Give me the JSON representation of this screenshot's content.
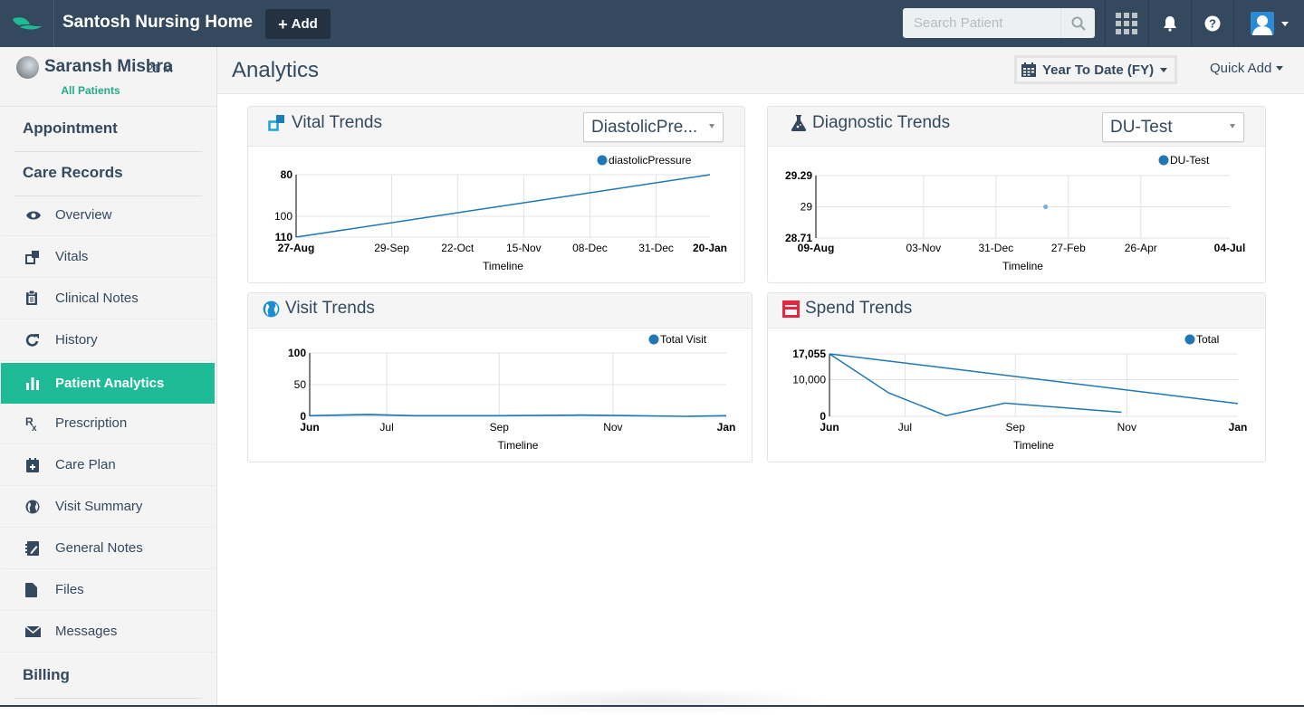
{
  "app": {
    "brand": "Santosh Nursing Home",
    "add_label": "Add",
    "search_placeholder": "Search Patient",
    "colors": {
      "nav": "#34495e",
      "accent": "#1fbb97",
      "link": "#27a98a",
      "series": "#1f77b4",
      "spend_icon": "#e8253e",
      "vital_icon": "#1aa3d6"
    }
  },
  "patient": {
    "name": "Saransh Mishra",
    "meta": "21 M",
    "all_patients": "All Patients"
  },
  "sidebar": {
    "sections": [
      {
        "label": "Appointment"
      },
      {
        "label": "Care Records"
      },
      {
        "label": "Billing"
      }
    ],
    "items": [
      {
        "label": "Overview",
        "icon": "eye-icon"
      },
      {
        "label": "Vitals",
        "icon": "vitals-icon"
      },
      {
        "label": "Clinical Notes",
        "icon": "clipboard-icon"
      },
      {
        "label": "History",
        "icon": "refresh-icon"
      },
      {
        "label": "Patient Analytics",
        "icon": "bar-chart-icon",
        "active": true
      },
      {
        "label": "Prescription",
        "icon": "rx-icon"
      },
      {
        "label": "Care Plan",
        "icon": "calendar-plus-icon"
      },
      {
        "label": "Visit Summary",
        "icon": "globe-icon"
      },
      {
        "label": "General Notes",
        "icon": "notebook-icon"
      },
      {
        "label": "Files",
        "icon": "file-icon"
      },
      {
        "label": "Messages",
        "icon": "envelope-icon"
      }
    ]
  },
  "header": {
    "title": "Analytics",
    "date_range": "Year To Date (FY)",
    "quick_add": "Quick Add"
  },
  "panels": {
    "vital": {
      "title": "Vital Trends",
      "selected": "DiastolicPre..."
    },
    "diagnostic": {
      "title": "Diagnostic Trends",
      "selected": "DU-Test"
    },
    "visit": {
      "title": "Visit Trends"
    },
    "spend": {
      "title": "Spend Trends"
    }
  },
  "chart_data": [
    {
      "id": "vital",
      "type": "line",
      "xlabel": "Timeline",
      "legend": [
        "diastolicPressure"
      ],
      "legend_position": "top-right",
      "x_ticks": [
        "27-Aug",
        "29-Sep",
        "22-Oct",
        "15-Nov",
        "08-Dec",
        "31-Dec",
        "20-Jan"
      ],
      "x_ticks_bold": [
        "27-Aug",
        "20-Jan"
      ],
      "y_ticks": [
        80,
        100,
        110
      ],
      "y_ticks_bold": [
        80,
        110
      ],
      "ylim": [
        110,
        80
      ],
      "y_inverted": true,
      "series": [
        {
          "name": "diastolicPressure",
          "x": [
            0,
            1
          ],
          "y": [
            110,
            80
          ]
        }
      ]
    },
    {
      "id": "diagnostic",
      "type": "scatter",
      "xlabel": "Timeline",
      "legend": [
        "DU-Test"
      ],
      "legend_position": "top-right",
      "x_ticks": [
        "09-Aug",
        "03-Nov",
        "31-Dec",
        "27-Feb",
        "26-Apr",
        "04-Jul"
      ],
      "x_ticks_bold": [
        "09-Aug",
        "04-Jul"
      ],
      "y_ticks": [
        29.29,
        29,
        28.71
      ],
      "y_ticks_bold": [
        29.29,
        28.71
      ],
      "ylim": [
        28.71,
        29.29
      ],
      "series": [
        {
          "name": "DU-Test",
          "x": [
            0.555
          ],
          "y": [
            29
          ]
        }
      ]
    },
    {
      "id": "visit",
      "type": "area",
      "xlabel": "Timeline",
      "legend": [
        "Total Visit"
      ],
      "legend_position": "top-right",
      "x_ticks": [
        "Jun",
        "Jul",
        "Sep",
        "Nov",
        "Jan"
      ],
      "x_ticks_bold": [
        "Jun",
        "Jan"
      ],
      "y_ticks": [
        100,
        50,
        0
      ],
      "y_ticks_bold": [
        100,
        0
      ],
      "ylim": [
        0,
        100
      ],
      "series": [
        {
          "name": "Total Visit",
          "x": [
            0,
            0.14,
            0.25,
            0.45,
            0.65,
            0.78,
            0.9,
            1
          ],
          "y": [
            1,
            3,
            1,
            1,
            2,
            1,
            0,
            1
          ]
        }
      ]
    },
    {
      "id": "spend",
      "type": "line",
      "xlabel": "Timeline",
      "legend": [
        "Total"
      ],
      "legend_position": "top-right",
      "x_ticks": [
        "Jun",
        "Jul",
        "Sep",
        "Nov",
        "Jan"
      ],
      "x_ticks_bold": [
        "Jun",
        "Jan"
      ],
      "y_ticks": [
        17055,
        10000,
        0
      ],
      "y_tick_labels": [
        "17,055",
        "10,000",
        "0"
      ],
      "y_ticks_bold": [
        17055,
        0
      ],
      "ylim": [
        0,
        17055
      ],
      "series": [
        {
          "name": "Total",
          "x": [
            0,
            1
          ],
          "y": [
            17055,
            3500
          ]
        },
        {
          "name": "Total",
          "x": [
            0,
            0.145,
            0.285,
            0.43,
            0.715
          ],
          "y": [
            17055,
            6400,
            200,
            3600,
            1100
          ]
        }
      ]
    }
  ]
}
